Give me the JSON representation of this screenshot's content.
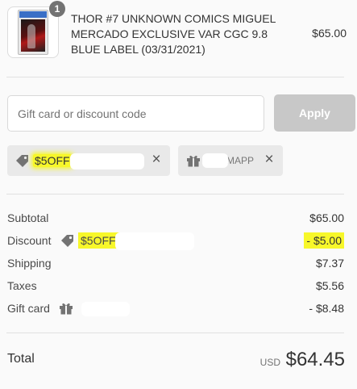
{
  "product": {
    "quantity": "1",
    "title": "THOR #7 UNKNOWN COMICS MIGUEL MERCADO EXCLUSIVE VAR CGC 9.8 BLUE LABEL (03/31/2021)",
    "price": "$65.00",
    "thumbnail_icon": "comic-slab-image"
  },
  "discount": {
    "placeholder": "Gift card or discount code",
    "apply_label": "Apply"
  },
  "applied_codes": [
    {
      "icon": "tag-icon",
      "code": "$5OFF"
    },
    {
      "icon": "gift-icon",
      "code": "MAPP"
    }
  ],
  "summary": {
    "subtotal_label": "Subtotal",
    "subtotal_value": "$65.00",
    "discount_label": "Discount",
    "discount_code": "$5OFF/",
    "discount_value": "- $5.00",
    "shipping_label": "Shipping",
    "shipping_value": "$7.37",
    "taxes_label": "Taxes",
    "taxes_value": "$5.56",
    "gift_card_label": "Gift card",
    "gift_card_value": "- $8.48"
  },
  "total": {
    "label": "Total",
    "currency": "USD",
    "value": "$64.45"
  },
  "colors": {
    "highlight": "#f7f72a",
    "apply_disabled": "#c8c8c8",
    "tag_background": "#e9e9e9"
  }
}
